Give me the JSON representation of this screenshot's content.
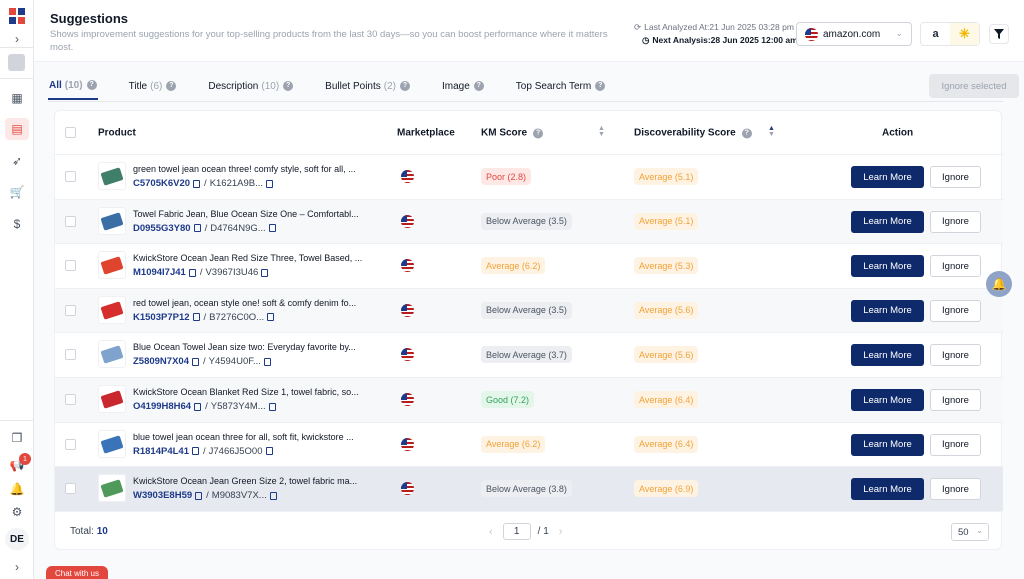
{
  "header": {
    "title": "Suggestions",
    "subtitle": "Shows improvement suggestions for your top-selling products from the last 30 days—so you can boost performance where it matters most.",
    "last_analyzed": "Last Analyzed At:21 Jun 2025 03:28 pm",
    "next_analysis": "Next Analysis:28 Jun 2025 12:00 am",
    "marketplace_value": "amazon.com",
    "store_amazon": "a",
    "store_walmart": "✳"
  },
  "sidebar": {
    "avatar_initial": "",
    "notification_count": "1",
    "user_initials": "DE"
  },
  "tabs": [
    {
      "label": "All",
      "count": "(10)"
    },
    {
      "label": "Title",
      "count": "(6)"
    },
    {
      "label": "Description",
      "count": "(10)"
    },
    {
      "label": "Bullet Points",
      "count": "(2)"
    },
    {
      "label": "Image",
      "count": ""
    },
    {
      "label": "Top Search Term",
      "count": ""
    }
  ],
  "ignore_selected_label": "Ignore selected",
  "table": {
    "headers": {
      "product": "Product",
      "marketplace": "Marketplace",
      "km_score": "KM Score",
      "discoverability": "Discoverability Score",
      "action": "Action"
    },
    "learn_more_label": "Learn More",
    "ignore_label": "Ignore",
    "rows": [
      {
        "name": "green towel jean ocean three! comfy style, soft for all, ...",
        "asin": "C5705K6V20",
        "sku": "K1621A9B...",
        "km": "Poor (2.8)",
        "km_level": "poor",
        "disc": "Average (5.1)",
        "disc_level": "average",
        "thumb_color": "#3f7f6a"
      },
      {
        "name": "Towel Fabric Jean, Blue Ocean Size One – Comfortabl...",
        "asin": "D0955G3Y80",
        "sku": "D4764N9G...",
        "km": "Below Average (3.5)",
        "km_level": "below",
        "disc": "Average (5.1)",
        "disc_level": "average",
        "thumb_color": "#3b6ea5"
      },
      {
        "name": "KwickStore Ocean Jean Red Size Three, Towel Based, ...",
        "asin": "M1094I7J41",
        "sku": "V3967I3U46",
        "km": "Average (6.2)",
        "km_level": "average",
        "disc": "Average (5.3)",
        "disc_level": "average",
        "thumb_color": "#e0442f"
      },
      {
        "name": "red towel jean, ocean style one! soft & comfy denim fo...",
        "asin": "K1503P7P12",
        "sku": "B7276C0O...",
        "km": "Below Average (3.5)",
        "km_level": "below",
        "disc": "Average (5.6)",
        "disc_level": "average",
        "thumb_color": "#d62d2d"
      },
      {
        "name": "Blue Ocean Towel Jean size two: Everyday favorite by...",
        "asin": "Z5809N7X04",
        "sku": "Y4594U0F...",
        "km": "Below Average (3.7)",
        "km_level": "below",
        "disc": "Average (5.6)",
        "disc_level": "average",
        "thumb_color": "#7fa3cc"
      },
      {
        "name": "KwickStore Ocean Blanket Red Size 1, towel fabric, so...",
        "asin": "O4199H8H64",
        "sku": "Y5873Y4M...",
        "km": "Good (7.2)",
        "km_level": "good",
        "disc": "Average (6.4)",
        "disc_level": "average",
        "thumb_color": "#c9282f"
      },
      {
        "name": "blue towel jean ocean three for all, soft fit, kwickstore ...",
        "asin": "R1814P4L41",
        "sku": "J7466J5O00",
        "km": "Average (6.2)",
        "km_level": "average",
        "disc": "Average (6.4)",
        "disc_level": "average",
        "thumb_color": "#3b73b9"
      },
      {
        "name": "KwickStore Ocean Jean Green Size 2, towel fabric ma...",
        "asin": "W3903E8H59",
        "sku": "M9083V7X...",
        "km": "Below Average (3.8)",
        "km_level": "below",
        "disc": "Average (6.9)",
        "disc_level": "average",
        "thumb_color": "#4f9a5a"
      }
    ]
  },
  "footer": {
    "total_label": "Total:",
    "total_value": "10",
    "page_current": "1",
    "page_total": "/ 1",
    "per_page": "50"
  },
  "chat_label": "Chat with us",
  "colors": {
    "primary": "#0f2a6b",
    "accent": "#e1473d",
    "poor": "#e1473d",
    "average": "#f0a23a",
    "good": "#2fa35a"
  }
}
